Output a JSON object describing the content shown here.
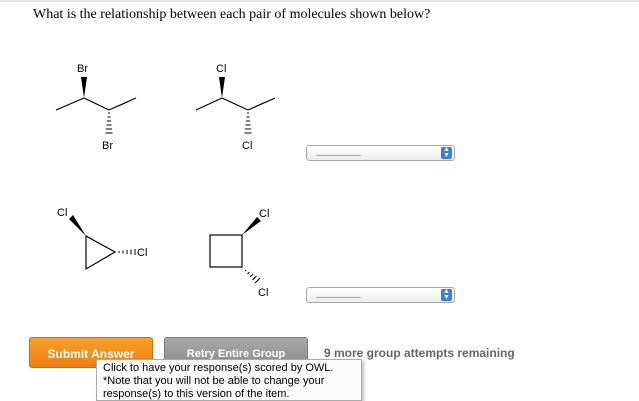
{
  "question": "What is the relationship between each pair of molecules shown below?",
  "molecules": {
    "pair1_left": {
      "top_label": "Br",
      "bottom_label": "Br"
    },
    "pair1_right": {
      "top_label": "Cl",
      "bottom_label": "Cl"
    },
    "pair2_left": {
      "label_a": "Cl",
      "label_b": "Cl"
    },
    "pair2_right": {
      "label_a": "Cl",
      "label_b": "Cl"
    }
  },
  "selects": [
    {
      "value": "----------------------",
      "icon": "up-down-arrows-icon"
    },
    {
      "value": "----------------------",
      "icon": "up-down-arrows-icon"
    }
  ],
  "buttons": {
    "submit": "Submit Answer",
    "retry": "Retry Entire Group"
  },
  "attempts_text": "9 more group attempts remaining",
  "tooltip": {
    "line1": "Click to have your response(s) scored by OWL.",
    "line2": "*Note that you will not be able to change your",
    "line3": "response(s) to this version of the item."
  },
  "colors": {
    "submit_orange": "#f07d10",
    "retry_gray": "#8c8c8c",
    "select_arrow_blue": "#3a7ee8"
  }
}
